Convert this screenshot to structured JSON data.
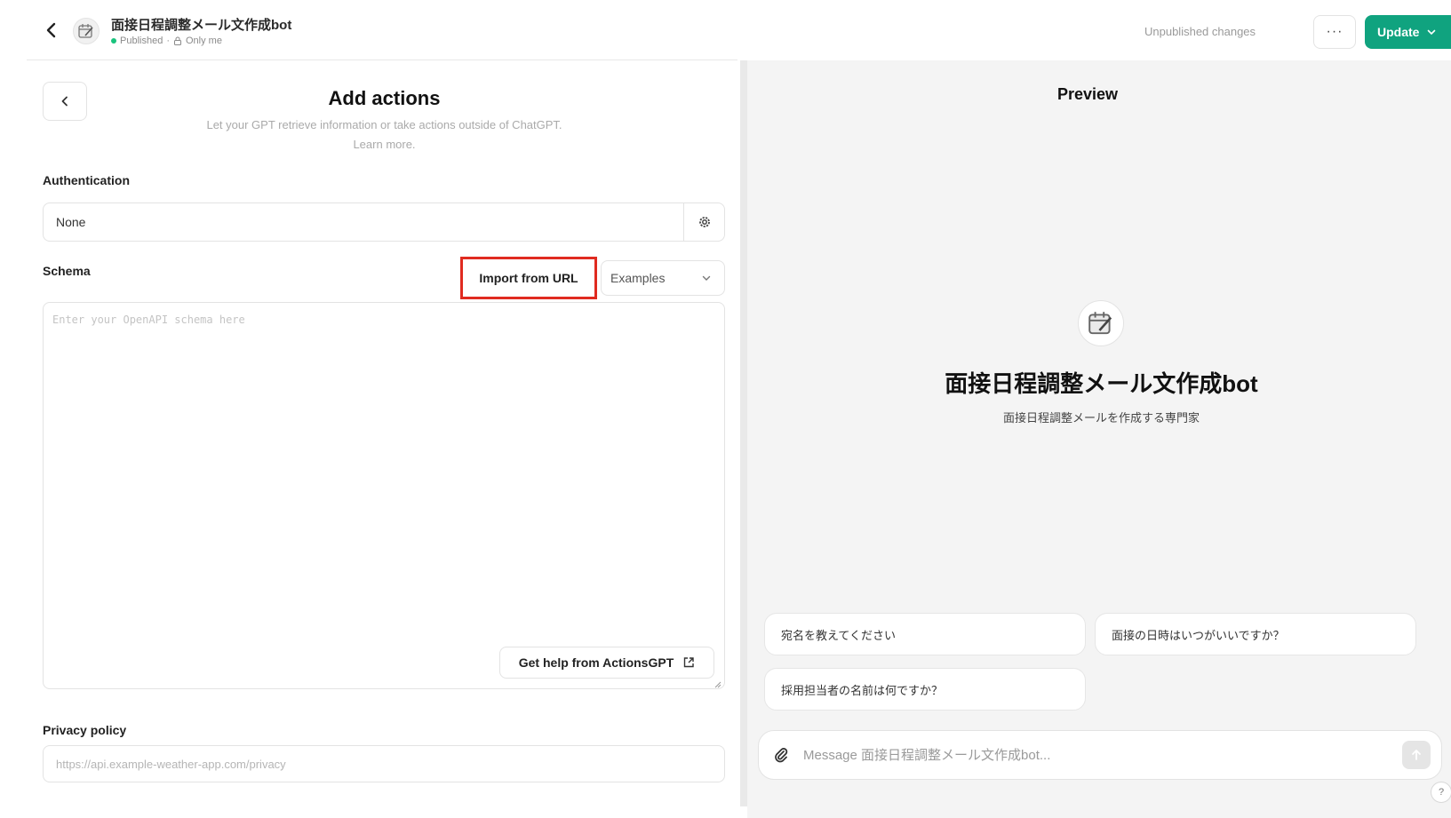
{
  "header": {
    "gpt_name": "面接日程調整メール文作成bot",
    "status": "Published",
    "separator": "·",
    "visibility": "Only me",
    "unpublished_label": "Unpublished changes",
    "more_label": "···",
    "update_label": "Update"
  },
  "editor": {
    "title": "Add actions",
    "subtitle": "Let your GPT retrieve information or take actions outside of ChatGPT.",
    "learn_more": "Learn more.",
    "authentication_label": "Authentication",
    "authentication_value": "None",
    "schema_label": "Schema",
    "import_label": "Import from URL",
    "examples_label": "Examples",
    "schema_placeholder": "Enter your OpenAPI schema here",
    "help_label": "Get help from ActionsGPT",
    "privacy_label": "Privacy policy",
    "privacy_placeholder": "https://api.example-weather-app.com/privacy"
  },
  "preview": {
    "title": "Preview",
    "gpt_name": "面接日程調整メール文作成bot",
    "description": "面接日程調整メールを作成する専門家",
    "starters": [
      "宛名を教えてください",
      "面接の日時はいつがいいですか？",
      "採用担当者の名前は何ですか？"
    ],
    "composer_placeholder": "Message 面接日程調整メール文作成bot...",
    "help_label": "?"
  },
  "colors": {
    "accent": "#10a37f",
    "highlight": "#e02b20"
  }
}
